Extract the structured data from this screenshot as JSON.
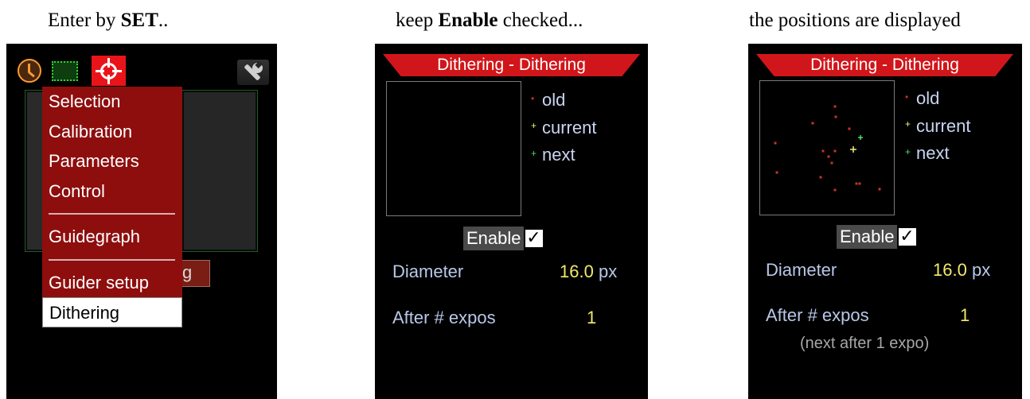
{
  "captions": {
    "first": {
      "pre": "Enter by ",
      "bold": "SET",
      "post": ".."
    },
    "second": {
      "pre": "keep ",
      "bold": "Enable",
      "post": " checked..."
    },
    "third": {
      "text": "the positions are displayed"
    }
  },
  "screen1": {
    "tabs": [
      {
        "icon": "clock-icon"
      },
      {
        "icon": "frame-icon"
      },
      {
        "icon": "target-icon",
        "active": true
      },
      {
        "icon": "wrench-icon"
      }
    ],
    "menu": {
      "items_top": [
        "Selection",
        "Calibration",
        "Parameters",
        "Control"
      ],
      "items_mid": [
        "Guidegraph"
      ],
      "items_bottom": [
        "Guider setup"
      ],
      "selected": "Dithering"
    },
    "background_button_fragment": "g"
  },
  "screen2": {
    "title": "Dithering - Dithering",
    "legend": {
      "old": "old",
      "current": "current",
      "next": "next"
    },
    "enable_label": "Enable",
    "enable_checked": "✓",
    "diameter_label": "Diameter",
    "diameter_value": "16.0",
    "diameter_unit": "px",
    "after_label": "After # expos",
    "after_value": "1"
  },
  "screen3": {
    "title": "Dithering - Dithering",
    "legend": {
      "old": "old",
      "current": "current",
      "next": "next"
    },
    "enable_label": "Enable",
    "enable_checked": "✓",
    "diameter_label": "Diameter",
    "diameter_value": "16.0",
    "diameter_unit": "px",
    "after_label": "After # expos",
    "after_value": "1",
    "next_note": "(next after 1 expo)"
  },
  "colors": {
    "menu_bg": "#8e0e0e",
    "title_bar": "#d0161a",
    "old_marker": "#c8322a",
    "current_marker": "#f4f07a",
    "next_marker": "#4ede5a",
    "value_text": "#f2ea6a"
  }
}
